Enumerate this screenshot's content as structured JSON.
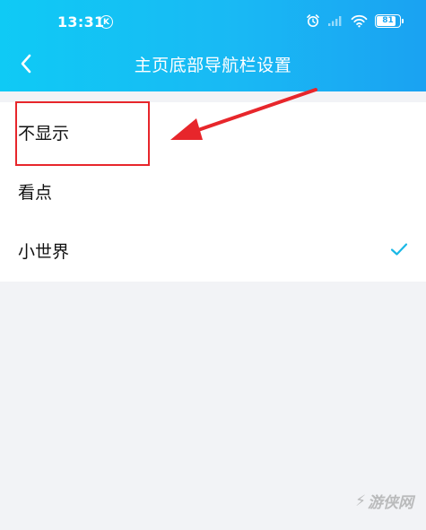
{
  "status_bar": {
    "time": "13:31",
    "k_badge": "K",
    "battery": "81",
    "icons": [
      "alarm-icon",
      "signal-icon",
      "wifi-icon",
      "battery-icon"
    ]
  },
  "header": {
    "title": "主页底部导航栏设置",
    "back_icon": "chevron-left-icon"
  },
  "options": [
    {
      "label": "不显示",
      "selected": false
    },
    {
      "label": "看点",
      "selected": false
    },
    {
      "label": "小世界",
      "selected": true
    }
  ],
  "colors": {
    "header_gradient_start": "#0fcaf5",
    "header_gradient_end": "#1aa2f2",
    "check": "#1ab8e6",
    "annotation": "#e7262b",
    "background": "#f2f3f6"
  },
  "watermark": {
    "text": "游侠网",
    "glyph": "⚡"
  }
}
